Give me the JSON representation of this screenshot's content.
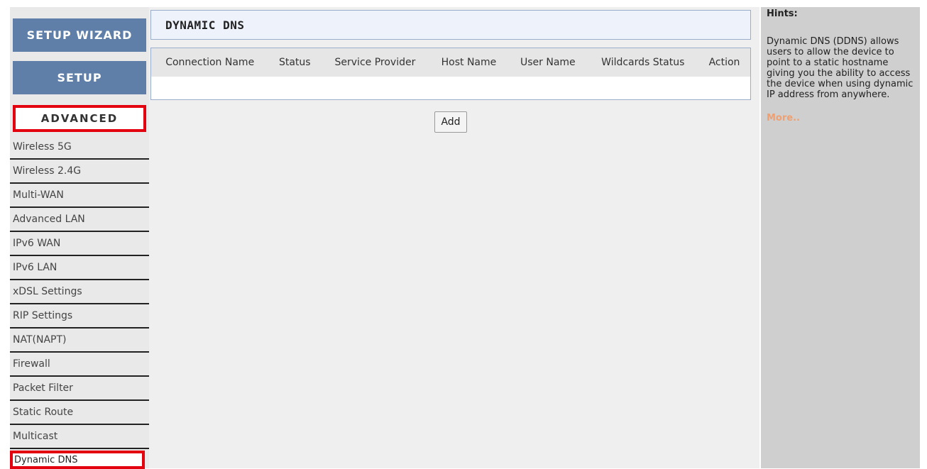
{
  "nav": {
    "wizard_label": "SETUP WIZARD",
    "setup_label": "SETUP",
    "advanced_label": "ADVANCED",
    "items": [
      {
        "label": "Wireless 5G"
      },
      {
        "label": "Wireless 2.4G"
      },
      {
        "label": "Multi-WAN"
      },
      {
        "label": "Advanced LAN"
      },
      {
        "label": "IPv6 WAN"
      },
      {
        "label": "IPv6 LAN"
      },
      {
        "label": "xDSL Settings"
      },
      {
        "label": "RIP Settings"
      },
      {
        "label": "NAT(NAPT)"
      },
      {
        "label": "Firewall"
      },
      {
        "label": "Packet Filter"
      },
      {
        "label": "Static Route"
      },
      {
        "label": "Multicast"
      },
      {
        "label": "Dynamic DNS"
      }
    ],
    "active_item": "Dynamic DNS"
  },
  "main": {
    "title": "DYNAMIC DNS",
    "table": {
      "columns": [
        "Connection Name",
        "Status",
        "Service Provider",
        "Host Name",
        "User Name",
        "Wildcards Status",
        "Action"
      ],
      "rows": []
    },
    "add_label": "Add"
  },
  "hints": {
    "title": "Hints:",
    "text": "Dynamic DNS (DDNS) allows users to allow the device to point to a static hostname giving you the ability to access the device when using dynamic IP address from anywhere.",
    "more_label": "More.."
  },
  "colors": {
    "nav_button": "#5f7fa8",
    "highlight": "#e3000f",
    "more_link": "#f0a070"
  }
}
